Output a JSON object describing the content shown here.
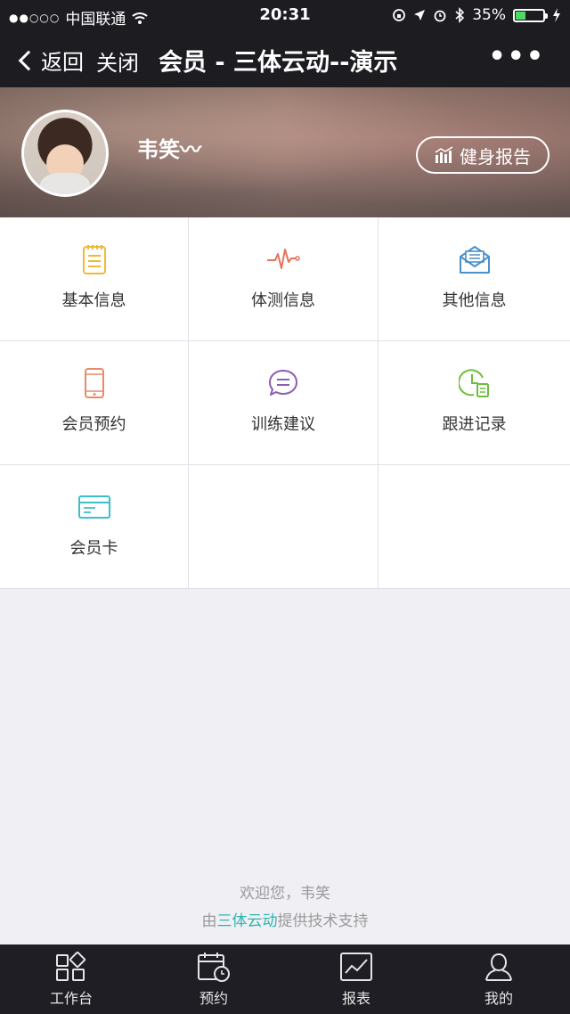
{
  "status_bar": {
    "signal": "●●○○○",
    "carrier": "中国联通",
    "time": "20:31",
    "battery_percent": "35%",
    "battery_level": 0.35
  },
  "nav": {
    "back_label": "返回",
    "close_label": "关闭",
    "title": "会员 - 三体云动--演示",
    "more_label": "•••"
  },
  "profile": {
    "name": "韦笑〰",
    "report_button": "健身报告"
  },
  "grid": {
    "items": [
      {
        "label": "基本信息",
        "icon": "notepad-icon",
        "color": "#f0b93b"
      },
      {
        "label": "体测信息",
        "icon": "heartbeat-icon",
        "color": "#e8735a"
      },
      {
        "label": "其他信息",
        "icon": "envelope-icon",
        "color": "#4a90c8"
      },
      {
        "label": "会员预约",
        "icon": "phone-icon",
        "color": "#e88a6a"
      },
      {
        "label": "训练建议",
        "icon": "chat-bubble-icon",
        "color": "#8e5bb5"
      },
      {
        "label": "跟进记录",
        "icon": "clock-document-icon",
        "color": "#6cbf3b"
      },
      {
        "label": "会员卡",
        "icon": "card-icon",
        "color": "#3ac0c8"
      }
    ]
  },
  "footer": {
    "welcome": "欢迎您，韦笑",
    "support_prefix": "由",
    "support_brand": "三体云动",
    "support_suffix": "提供技术支持",
    "brand_color": "#2bb5b0"
  },
  "tabbar": {
    "items": [
      {
        "label": "工作台",
        "icon": "workbench-icon"
      },
      {
        "label": "预约",
        "icon": "calendar-clock-icon"
      },
      {
        "label": "报表",
        "icon": "line-chart-icon"
      },
      {
        "label": "我的",
        "icon": "person-icon"
      }
    ]
  }
}
